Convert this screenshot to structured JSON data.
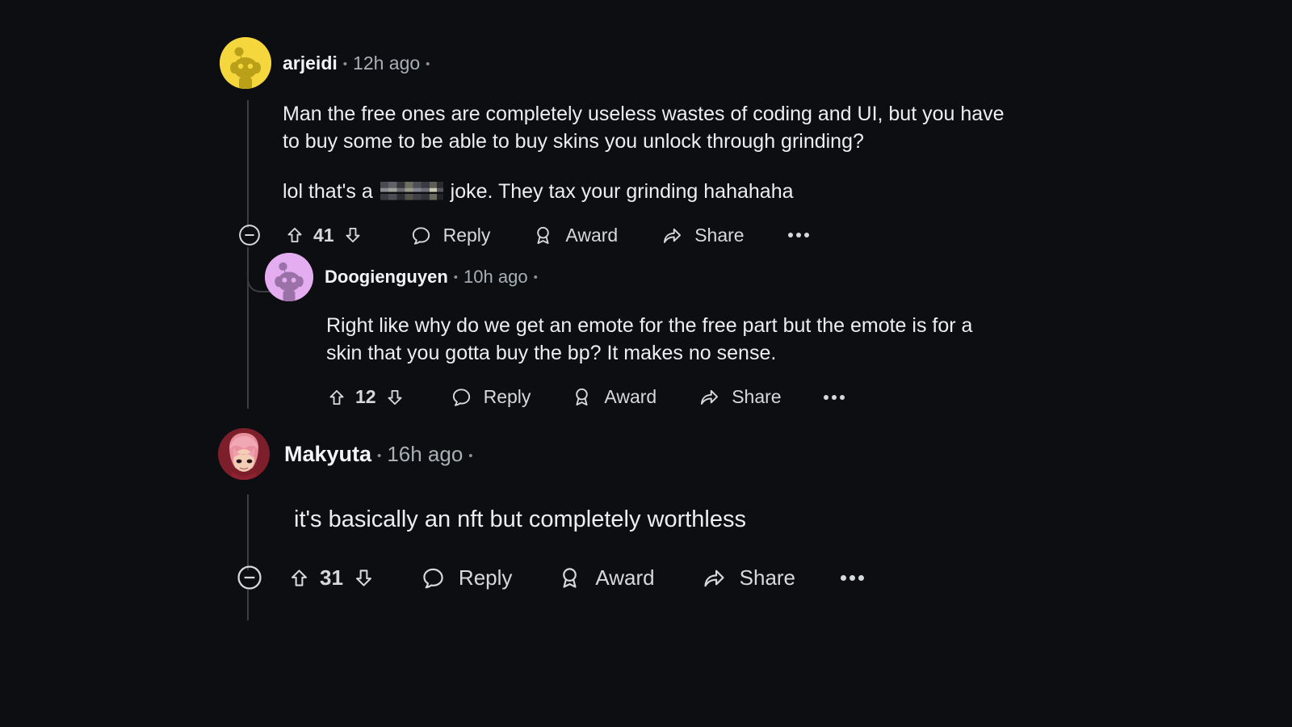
{
  "theme": {
    "background": "#0d0e11",
    "text_primary": "#edeef0",
    "text_muted": "#a8b0b4",
    "thread_line": "#3a3d42"
  },
  "separator": "•",
  "comments": [
    {
      "id": "comment-1",
      "author": "arjeidi",
      "timestamp": "12h ago",
      "avatar": "snoo-yellow-avatar",
      "paragraphs": [
        "Man the free ones are completely useless wastes of coding and UI, but you have to buy some to be able to buy skins you unlock through grinding?",
        "lol that's a ",
        " joke. They tax your grinding hahahaha"
      ],
      "has_censored_word": true,
      "score": "41",
      "has_collapse": true,
      "actions": {
        "reply": "Reply",
        "award": "Award",
        "share": "Share"
      }
    },
    {
      "id": "comment-2",
      "author": "Doogienguyen",
      "timestamp": "10h ago",
      "avatar": "snoo-purple-avatar",
      "paragraphs": [
        "Right like why do we get an emote for the free part but the emote is for a skin that you gotta buy the bp? It makes no sense."
      ],
      "score": "12",
      "has_collapse": false,
      "actions": {
        "reply": "Reply",
        "award": "Award",
        "share": "Share"
      }
    },
    {
      "id": "comment-3",
      "author": "Makyuta",
      "timestamp": "16h ago",
      "avatar": "anime-character-avatar",
      "paragraphs": [
        "it's basically an nft but completely worthless"
      ],
      "score": "31",
      "has_collapse": true,
      "actions": {
        "reply": "Reply",
        "award": "Award",
        "share": "Share"
      }
    }
  ]
}
